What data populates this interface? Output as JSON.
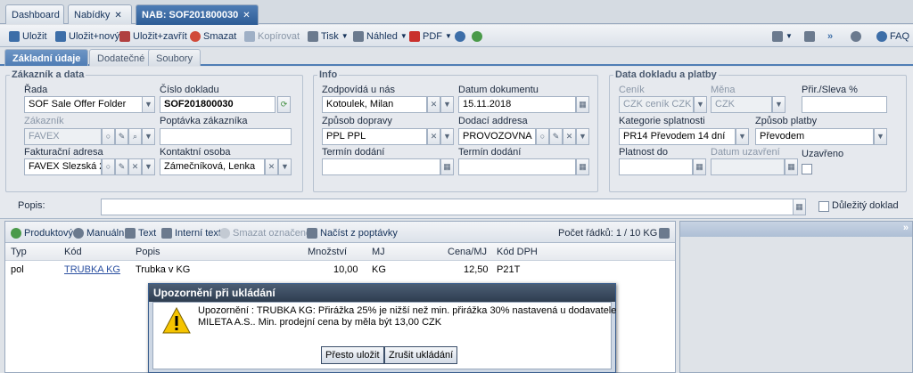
{
  "tabs": [
    {
      "label": "Dashboard"
    },
    {
      "label": "Nabídky"
    },
    {
      "label": "NAB: SOF201800030"
    }
  ],
  "toolbar": {
    "save": "Uložit",
    "save_new": "Uložit+nový",
    "save_close": "Uložit+zavřít",
    "delete": "Smazat",
    "copy": "Kopírovat",
    "print": "Tisk",
    "preview": "Náhled",
    "pdf": "PDF",
    "faq": "FAQ"
  },
  "subtabs": [
    "Základní údaje",
    "Dodatečné",
    "Soubory"
  ],
  "customer": {
    "legend": "Zákazník a data",
    "rada_label": "Řada",
    "rada_value": "SOF Sale Offer Folder",
    "cislo_label": "Číslo dokladu",
    "cislo_value": "SOF201800030",
    "zakaznik_label": "Zákazník",
    "zakaznik_value": "FAVEX",
    "poptavka_label": "Poptávka zákazníka",
    "poptavka_value": "",
    "fakt_label": "Fakturační adresa",
    "fakt_value": "FAVEX  Slezská 2",
    "kontakt_label": "Kontaktní osoba",
    "kontakt_value": "Zámečníková, Lenka"
  },
  "info": {
    "legend": "Info",
    "zodpovida_label": "Zodpovídá u nás",
    "zodpovida_value": "Kotoulek, Milan",
    "datum_label": "Datum dokumentu",
    "datum_value": "15.11.2018",
    "doprava_label": "Způsob dopravy",
    "doprava_value": "PPL   PPL",
    "dodaci_label": "Dodací addresa",
    "dodaci_value": "PROVOZOVNA  H",
    "termin1_label": "Termín dodání",
    "termin2_label": "Termín dodání"
  },
  "payment": {
    "legend": "Data dokladu a platby",
    "cenik_label": "Ceník",
    "cenik_value": "CZK ceník CZK |",
    "mena_label": "Měna",
    "mena_value": "CZK",
    "prir_label": "Přir./Sleva %",
    "kat_label": "Kategorie splatnosti",
    "kat_value": "PR14 Převodem 14 dní",
    "zpusob_label": "Způsob platby",
    "zpusob_value": "Převodem",
    "platnost_label": "Platnost do",
    "datum_uzav_label": "Datum uzavření",
    "uzavreno_label": "Uzavřeno"
  },
  "popis_label": "Popis:",
  "dulezity_label": "Důležitý doklad",
  "grid": {
    "toolbar": {
      "produktovy": "Produktový",
      "manualni": "Manuální",
      "text": "Text",
      "interni": "Interní text",
      "smazat": "Smazat označené",
      "nacist": "Načíst z poptávky",
      "count": "Počet řádků: 1 / 10 KG"
    },
    "headers": [
      "Typ",
      "Kód",
      "Popis",
      "Množství",
      "MJ",
      "Cena/MJ",
      "Kód DPH"
    ],
    "rows": [
      [
        "pol",
        "TRUBKA KG",
        "Trubka v KG",
        "10,00",
        "KG",
        "12,50",
        "P21T"
      ]
    ]
  },
  "modal": {
    "title": "Upozornění při ukládání",
    "line1": "Upozornění : TRUBKA KG: Přirážka 25% je nižší než min. přirážka 30% nastavená u dodavatele",
    "line2": "MILETA A.S.. Min. prodejní cena by měla být 13,00 CZK",
    "ok": "Přesto uložit",
    "cancel": "Zrušit ukládání"
  },
  "colors": {
    "accent": "#4f7db5",
    "warning": "#f5c400"
  }
}
